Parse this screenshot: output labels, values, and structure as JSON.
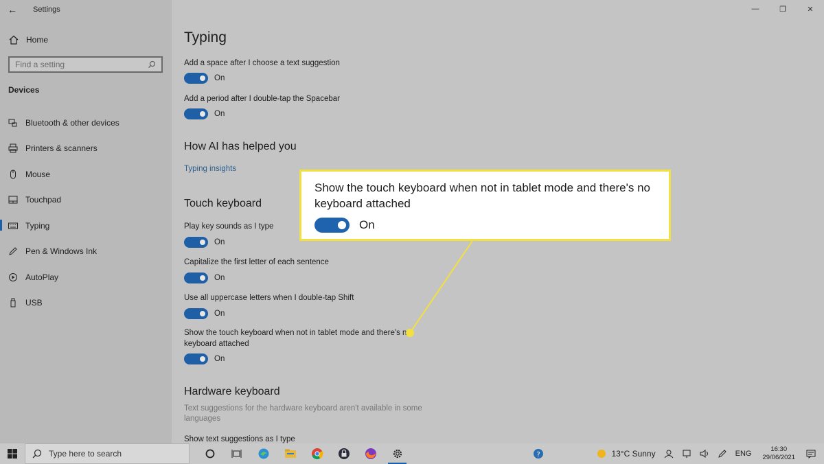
{
  "window": {
    "title": "Settings",
    "minimize_glyph": "—",
    "maximize_glyph": "❐",
    "close_glyph": "✕"
  },
  "sidebar": {
    "home_label": "Home",
    "search_placeholder": "Find a setting",
    "section_title": "Devices",
    "items": [
      {
        "label": "Bluetooth & other devices",
        "icon": "bluetooth-icon"
      },
      {
        "label": "Printers & scanners",
        "icon": "printer-icon"
      },
      {
        "label": "Mouse",
        "icon": "mouse-icon"
      },
      {
        "label": "Touchpad",
        "icon": "touchpad-icon"
      },
      {
        "label": "Typing",
        "icon": "keyboard-icon",
        "active": true
      },
      {
        "label": "Pen & Windows Ink",
        "icon": "pen-icon"
      },
      {
        "label": "AutoPlay",
        "icon": "autoplay-icon"
      },
      {
        "label": "USB",
        "icon": "usb-icon"
      }
    ]
  },
  "main": {
    "title": "Typing",
    "typing": {
      "add_space_label": "Add a space after I choose a text suggestion",
      "add_space_state": "On",
      "add_period_label": "Add a period after I double-tap the Spacebar",
      "add_period_state": "On"
    },
    "ai": {
      "heading": "How AI has helped you",
      "link": "Typing insights"
    },
    "touch_keyboard": {
      "heading": "Touch keyboard",
      "key_sounds_label": "Play key sounds as I type",
      "key_sounds_state": "On",
      "capitalize_label": "Capitalize the first letter of each sentence",
      "capitalize_state": "On",
      "uppercase_label": "Use all uppercase letters when I double-tap Shift",
      "uppercase_state": "On",
      "show_touch_label_line1": "Show the touch keyboard when not in tablet mode and there's no",
      "show_touch_label_line2": "keyboard attached",
      "show_touch_state": "On"
    },
    "hardware_keyboard": {
      "heading": "Hardware keyboard",
      "desc_line1": "Text suggestions for the hardware keyboard aren't available in some",
      "desc_line2": "languages",
      "show_suggestions_label": "Show text suggestions as I type"
    }
  },
  "callout": {
    "text": "Show the touch keyboard when not in tablet mode and there's no keyboard attached",
    "state": "On",
    "accent": "#f2e040"
  },
  "taskbar": {
    "search_placeholder": "Type here to search",
    "weather": "13°C  Sunny",
    "language": "ENG",
    "time": "16:30",
    "date": "29/06/2021"
  },
  "colors": {
    "accent": "#1f5fa6",
    "highlight": "#f2e040"
  }
}
